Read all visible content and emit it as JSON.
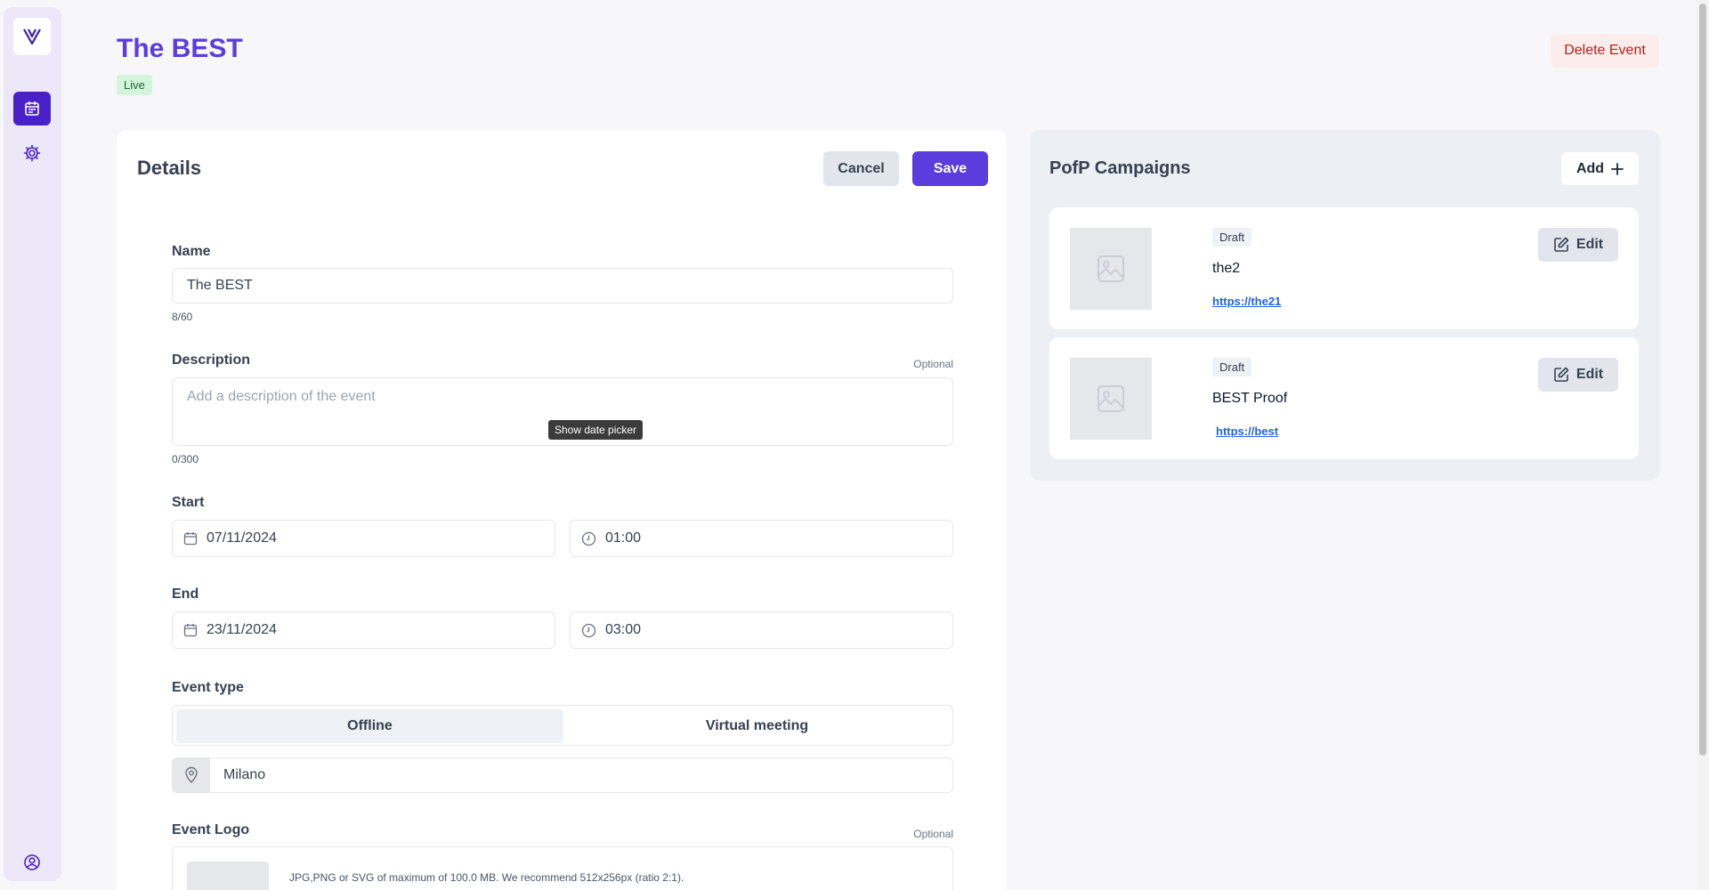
{
  "sidebar": {
    "logo": "V",
    "items": [
      {
        "icon": "calendar-icon",
        "active": true
      },
      {
        "icon": "gear-icon",
        "active": false
      }
    ],
    "bottom_icon": "user-circle-icon"
  },
  "header": {
    "title": "The BEST",
    "status": "Live",
    "delete_label": "Delete Event"
  },
  "details": {
    "title": "Details",
    "cancel_label": "Cancel",
    "save_label": "Save",
    "name": {
      "label": "Name",
      "value": "The BEST",
      "counter": "8/60"
    },
    "description": {
      "label": "Description",
      "optional": "Optional",
      "placeholder": "Add a description of the event",
      "counter": "0/300"
    },
    "start": {
      "label": "Start",
      "date": "07/11/2024",
      "time": "01:00"
    },
    "tooltip": "Show date picker",
    "end": {
      "label": "End",
      "date": "23/11/2024",
      "time": "03:00"
    },
    "event_type": {
      "label": "Event type",
      "options": [
        "Offline",
        "Virtual meeting"
      ],
      "selected": "Offline"
    },
    "location": "Milano",
    "event_logo": {
      "label": "Event Logo",
      "optional": "Optional",
      "hint": "JPG,PNG or SVG of maximum of 100.0 MB. We recommend 512x256px (ratio 2:1)."
    }
  },
  "campaigns": {
    "title": "PofP Campaigns",
    "add_label": "Add",
    "items": [
      {
        "status": "Draft",
        "name": "the2",
        "link": "https://the21",
        "edit_label": "Edit"
      },
      {
        "status": "Draft",
        "name": "BEST Proof",
        "link": "https://best",
        "edit_label": "Edit"
      }
    ]
  },
  "colors": {
    "accent": "#5b3cdc",
    "sidebar_active": "#4a21c9",
    "live_bg": "#d4f5dc",
    "danger": "#b42318",
    "link": "#2563eb"
  }
}
